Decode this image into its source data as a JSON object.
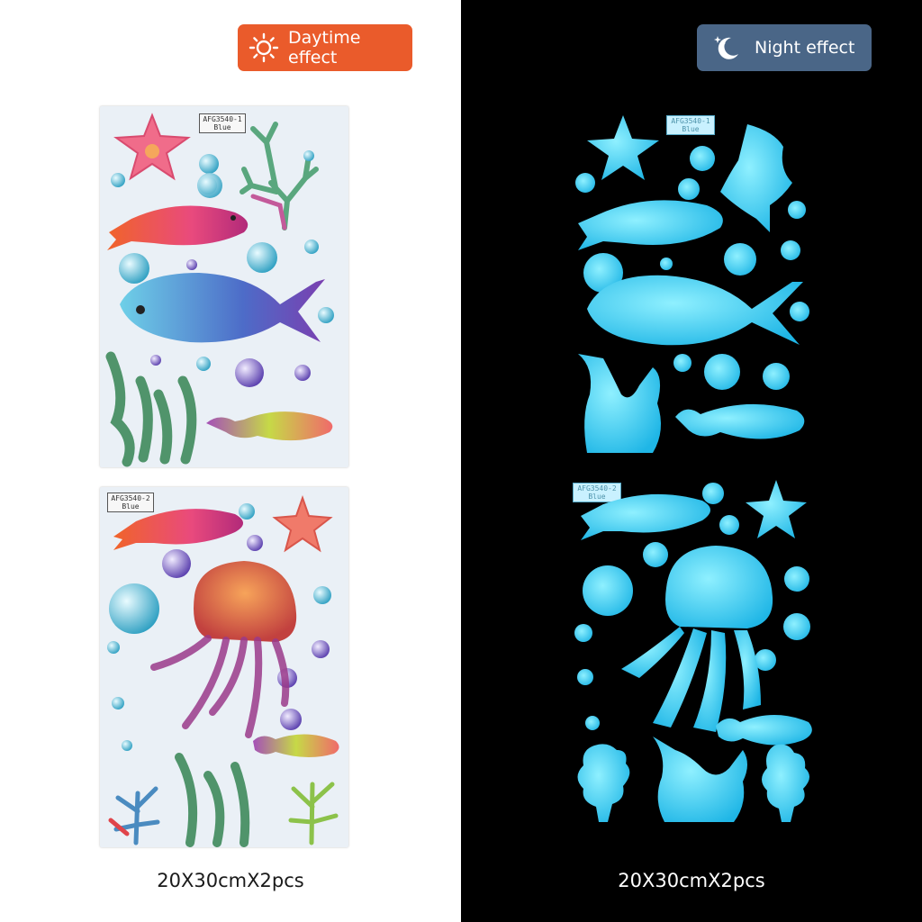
{
  "badges": {
    "day": {
      "label": "Daytime effect",
      "icon": "sun-icon",
      "color": "#ea5b2b"
    },
    "night": {
      "label": "Night effect",
      "icon": "moon-stars-icon",
      "color": "#4a6687"
    }
  },
  "sheets": {
    "top_code": "AFG3540-1",
    "top_color": "Blue",
    "bottom_code": "AFG3540-2",
    "bottom_color": "Blue"
  },
  "captions": {
    "day": "20X30cmX2pcs",
    "night": "20X30cmX2pcs"
  },
  "colors": {
    "glow": "#3fd3ff",
    "night_background": "#000000",
    "day_background": "#ffffff"
  }
}
